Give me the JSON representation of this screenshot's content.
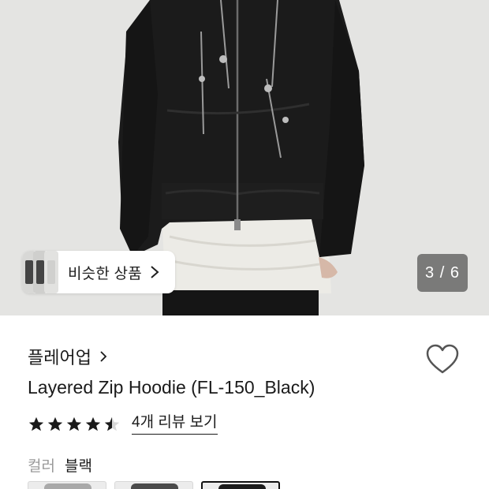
{
  "gallery": {
    "similar_label": "비슷한 상품",
    "counter": "3 / 6"
  },
  "product": {
    "brand": "플레어업",
    "title": "Layered Zip Hoodie (FL-150_Black)",
    "rating": 4.5,
    "review_link": "4개 리뷰 보기",
    "color_key": "컬러",
    "color_value": "블랙",
    "swatches": [
      "grey",
      "charcoal",
      "black"
    ],
    "selected_swatch": "black"
  },
  "colors": {
    "star": "#1a1a1a",
    "heart_outline": "#555555",
    "counter_bg": "#505050",
    "photo_bg": "#e4e4e2"
  },
  "icons": {
    "similar_chevron": "chevron-right-icon",
    "brand_chevron": "chevron-right-icon",
    "wishlist": "heart-outline-icon",
    "star": "star-icon"
  }
}
